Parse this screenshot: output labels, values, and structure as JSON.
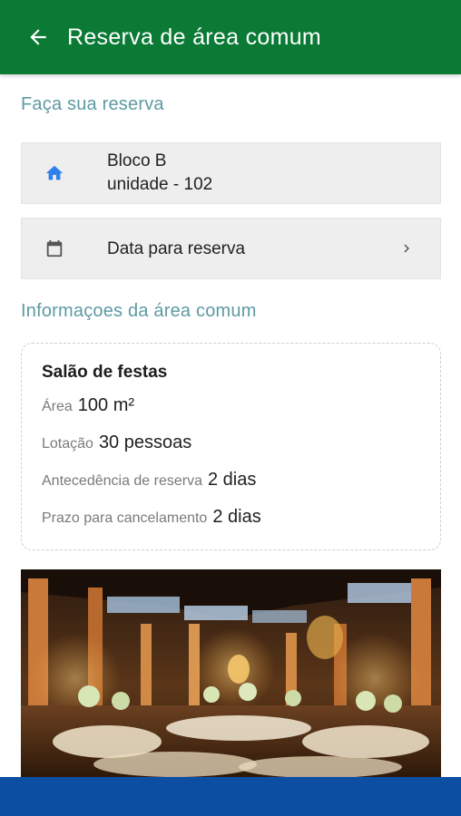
{
  "appbar": {
    "title": "Reserva de área comum",
    "back_icon": "arrow-back-icon",
    "color": "#0a7a35"
  },
  "reservation": {
    "section_title": "Faça sua reserva",
    "unit": {
      "icon": "home-icon",
      "block": "Bloco B",
      "unit": "unidade - 102"
    },
    "date": {
      "icon": "calendar-icon",
      "label": "Data para reserva",
      "chevron_icon": "chevron-right-icon"
    }
  },
  "area_info": {
    "section_title": "Informaçoes da área comum",
    "name": "Salão de festas",
    "lines": [
      {
        "label": "Área",
        "value": "100 m²"
      },
      {
        "label": "Lotação",
        "value": "30 pessoas"
      },
      {
        "label": "Antecedência de reserva",
        "value": "2 dias"
      },
      {
        "label": "Prazo para cancelamento",
        "value": "2 dias"
      }
    ]
  },
  "photo": {
    "subject": "banquet hall with set tables and chandeliers"
  },
  "bottom_bar": {
    "color": "#0b4ea2"
  }
}
